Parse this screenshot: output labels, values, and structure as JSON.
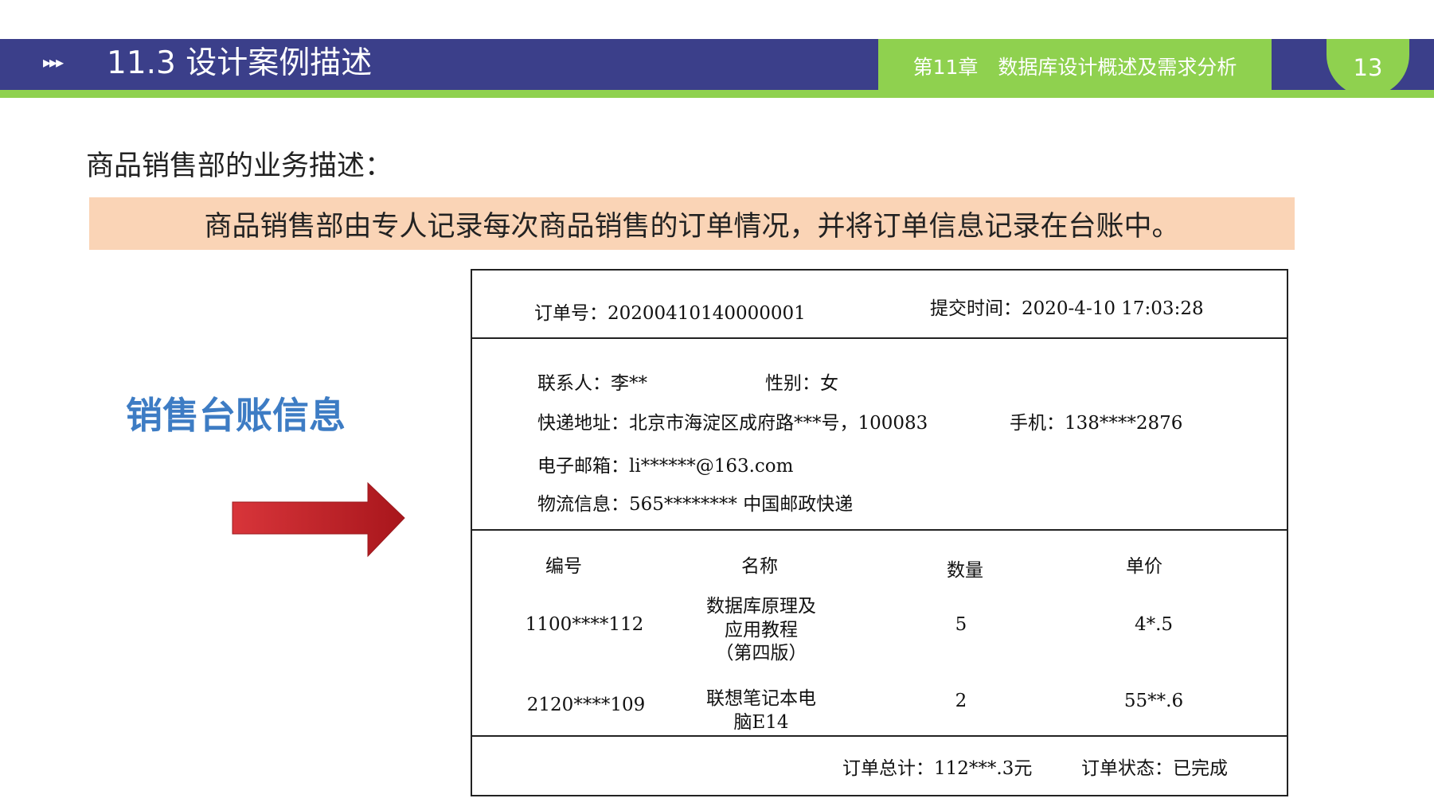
{
  "header": {
    "section_arrows": "▸▸▸",
    "section_title": "11.3  设计案例描述",
    "chapter_title": "第11章　数据库设计概述及需求分析",
    "page_number": "13"
  },
  "content": {
    "business_heading": "商品销售部的业务描述：",
    "highlight_text": "商品销售部由专人记录每次商品销售的订单情况，并将订单信息记录在台账中。",
    "ledger_label": "销售台账信息"
  },
  "order": {
    "order_no": "订单号：20200410140000001",
    "submit_time": "提交时间：2020-4-10 17:03:28",
    "contact": "联系人：李**",
    "gender": "性别：女",
    "address": "快递地址：北京市海淀区成府路***号，100083",
    "phone": "手机：138****2876",
    "email": "电子邮箱：li******@163.com",
    "logistics": "物流信息：565******** 中国邮政快递",
    "columns": [
      "编号",
      "名称",
      "数量",
      "单价"
    ],
    "items": [
      {
        "id": "1100****112",
        "name_lines": [
          "数据库原理及",
          "应用教程",
          "（第四版）"
        ],
        "qty": "5",
        "price": "4*.5"
      },
      {
        "id": "2120****109",
        "name_lines": [
          "联想笔记本电",
          "脑E14"
        ],
        "qty": "2",
        "price": "55**.6"
      }
    ],
    "total": "订单总计：112***.3元",
    "status": "订单状态：已完成"
  },
  "colors": {
    "header_band": "#3b3f8a",
    "accent_green": "#8fd14f",
    "highlight_bg": "#fad4b6",
    "ledger_label": "#3d7cc4",
    "arrow_red": "#c8262c"
  }
}
